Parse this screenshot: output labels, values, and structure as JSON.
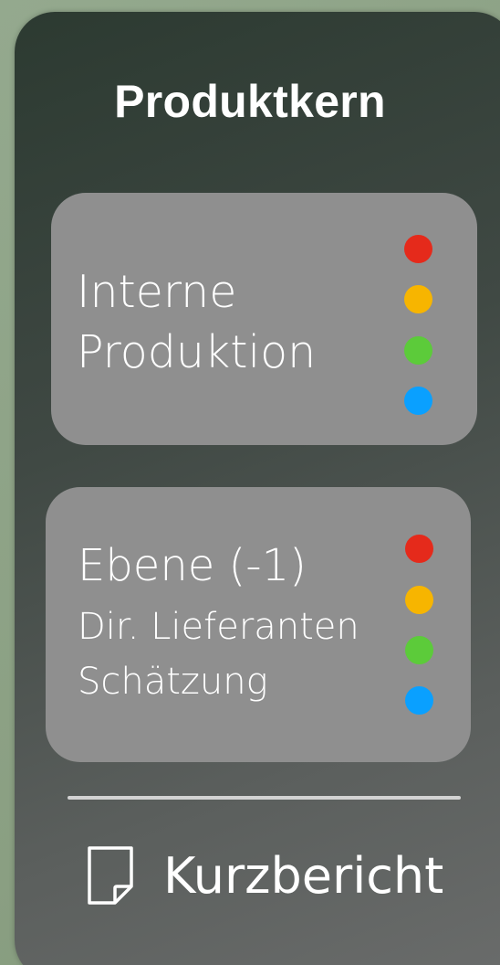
{
  "panel": {
    "title": "Produktkern"
  },
  "cards": [
    {
      "lines": [
        "Interne",
        "Produktion"
      ],
      "status_dots": [
        "#e52a1b",
        "#f7b500",
        "#5ccb3a",
        "#0aa0ff"
      ]
    },
    {
      "lines": [
        "Ebene (-1)",
        "Dir.  Lieferanten",
        "Schätzung"
      ],
      "status_dots": [
        "#e52a1b",
        "#f7b500",
        "#5ccb3a",
        "#0aa0ff"
      ]
    }
  ],
  "footer": {
    "report_icon": "document-icon",
    "report_label": "Kurzbericht"
  }
}
